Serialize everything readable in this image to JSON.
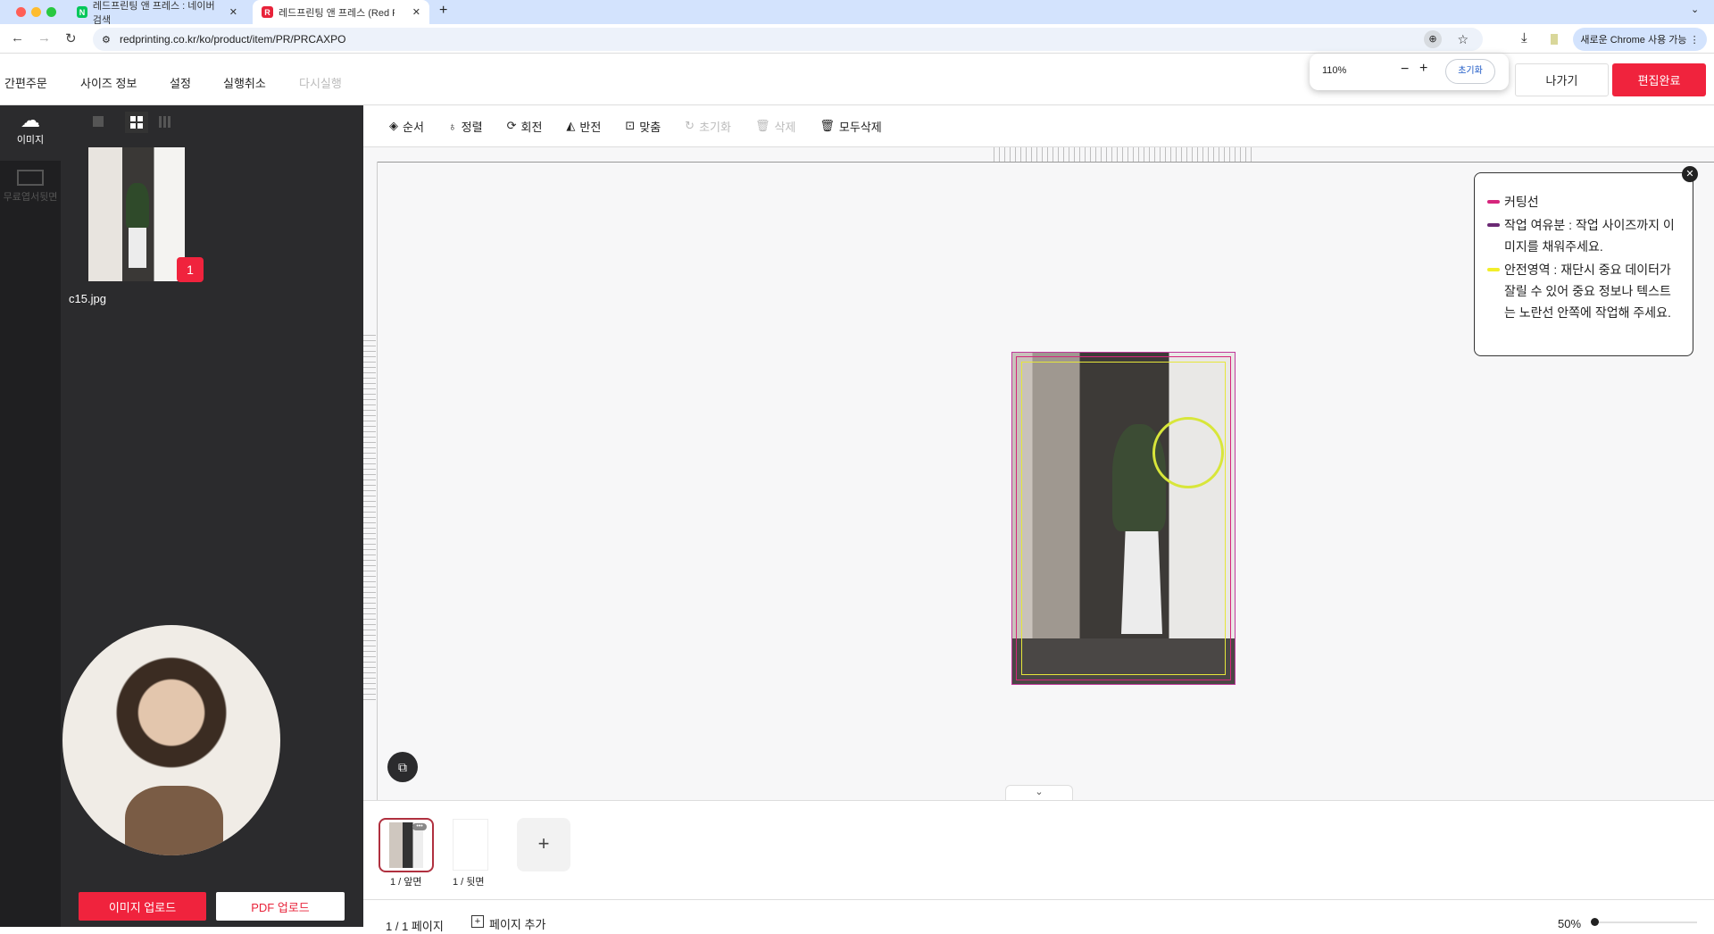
{
  "browser": {
    "tabs": [
      {
        "label": "레드프린팅 앤 프레스 : 네이버 검색",
        "favicon": "N"
      },
      {
        "label": "레드프린팅 앤 프레스 (Red Printi",
        "favicon": "R"
      }
    ],
    "url": "redprinting.co.kr/ko/product/item/PR/PRCAXPO",
    "update_label": "새로운 Chrome 사용 가능",
    "zoom_popup": {
      "value": "110%",
      "minus": "−",
      "plus": "+",
      "reset": "초기화"
    }
  },
  "header": {
    "menu": [
      "간편주문",
      "사이즈 정보",
      "설정",
      "실행취소",
      "다시실행"
    ],
    "exit": "나가기",
    "done": "편집완료"
  },
  "rail": {
    "items": [
      {
        "label": "이미지",
        "icon": "cloud-upload-icon"
      },
      {
        "label": "무료엽서뒷면",
        "icon": "postcard-icon"
      }
    ]
  },
  "panel": {
    "images": [
      {
        "name": "c15.jpg",
        "badge": "1"
      }
    ],
    "upload_image": "이미지 업로드",
    "upload_pdf": "PDF 업로드"
  },
  "toolbar": [
    "순서",
    "정렬",
    "회전",
    "반전",
    "맞춤",
    "초기화",
    "삭제",
    "모두삭제"
  ],
  "legend": {
    "items": [
      {
        "text": "커팅선",
        "color": "#d6257c"
      },
      {
        "text": "작업 여유분 : 작업 사이즈까지 이미지를 채워주세요.",
        "color": "#6b2a74"
      },
      {
        "text": "안전영역 : 재단시 중요 데이터가 잘릴 수 있어 중요 정보나 텍스트는 노란선 안쪽에 작업해 주세요.",
        "color": "#f2ee2a"
      }
    ]
  },
  "pages": {
    "thumbs": [
      "1 / 앞면",
      "1 / 뒷면"
    ],
    "add": "+"
  },
  "footer": {
    "page_count": "1 / 1 페이지",
    "add_page": "페이지 추가",
    "zoom": "50%",
    "zoom_fraction": 0.0
  },
  "colors": {
    "accent": "#f0233d"
  }
}
